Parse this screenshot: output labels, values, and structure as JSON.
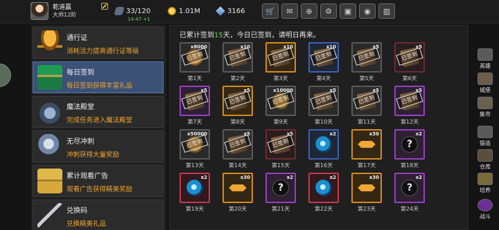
{
  "player": {
    "name": "乾道赢",
    "rank": "大师12阶",
    "timer": "14:47 +1"
  },
  "resources": [
    {
      "icon": "energy-icon",
      "value": "33/120"
    },
    {
      "icon": "gold-coin-icon",
      "value": "1.01M"
    },
    {
      "icon": "diamond-icon",
      "value": "3166"
    }
  ],
  "toolbar": [
    {
      "icon": "shop-cart-icon",
      "glyph": "🛒"
    },
    {
      "icon": "mail-icon",
      "glyph": "✉"
    },
    {
      "icon": "gamepad-icon",
      "glyph": "⊕"
    },
    {
      "icon": "settings-gear-icon",
      "glyph": "⚙"
    },
    {
      "icon": "gift-icon",
      "glyph": "▣"
    },
    {
      "icon": "color-wheel-icon",
      "glyph": "◉"
    },
    {
      "icon": "stats-chart-icon",
      "glyph": "▥"
    }
  ],
  "menu": [
    {
      "title": "通行证",
      "subtitle": "消耗活力提高通行证等级"
    },
    {
      "title": "每日签到",
      "subtitle": "每日签到获得丰富礼品"
    },
    {
      "title": "魔法殿堂",
      "subtitle": "完成任务进入魔法殿堂"
    },
    {
      "title": "无尽冲刺",
      "subtitle": "冲刺获得大量奖励"
    },
    {
      "title": "累计观看广告",
      "subtitle": "观看广告获得精美奖励"
    },
    {
      "title": "兑换码",
      "subtitle": "兑换精美礼品"
    }
  ],
  "main": {
    "msg_prefix": "已累计签到",
    "msg_count": "15",
    "msg_suffix": "天，今日已签到，请明日再来。"
  },
  "signed_label": "已签到",
  "rewards": [
    {
      "day": "第1天",
      "qty": "x8000",
      "item": "gold-coin",
      "rarity": "gray",
      "signed": true
    },
    {
      "day": "第2天",
      "qty": "x10",
      "item": "card-pack",
      "rarity": "gray",
      "signed": true
    },
    {
      "day": "第3天",
      "qty": "x10",
      "item": "card-pack",
      "rarity": "orange",
      "signed": true
    },
    {
      "day": "第4天",
      "qty": "x10",
      "item": "card-pack",
      "rarity": "blue",
      "signed": true
    },
    {
      "day": "第5天",
      "qty": "x5",
      "item": "card-pack",
      "rarity": "gray",
      "signed": true
    },
    {
      "day": "第6天",
      "qty": "x5",
      "item": "card-pack",
      "rarity": "darkred",
      "signed": true
    },
    {
      "day": "第7天",
      "qty": "x5",
      "item": "card-pack",
      "rarity": "purple",
      "signed": true
    },
    {
      "day": "第8天",
      "qty": "x5",
      "item": "card-pack",
      "rarity": "orange",
      "signed": true
    },
    {
      "day": "第9天",
      "qty": "x10000",
      "item": "gold-coin",
      "rarity": "gray",
      "signed": true
    },
    {
      "day": "第10天",
      "qty": "x5",
      "item": "card-pack",
      "rarity": "gray",
      "signed": true
    },
    {
      "day": "第11天",
      "qty": "x5",
      "item": "card-pack",
      "rarity": "gray",
      "signed": true
    },
    {
      "day": "第12天",
      "qty": "x5",
      "item": "card-pack",
      "rarity": "purple",
      "signed": true
    },
    {
      "day": "第13天",
      "qty": "x50000",
      "item": "gold-coin",
      "rarity": "gray",
      "signed": true
    },
    {
      "day": "第14天",
      "qty": "x5",
      "item": "card-pack",
      "rarity": "gray",
      "signed": true
    },
    {
      "day": "第15天",
      "qty": "x5",
      "item": "card-pack",
      "rarity": "darkred",
      "signed": true
    },
    {
      "day": "第16天",
      "qty": "x2",
      "item": "blue-orb",
      "rarity": "blue",
      "signed": false
    },
    {
      "day": "第17天",
      "qty": "x30",
      "item": "crystal",
      "rarity": "orange",
      "signed": false
    },
    {
      "day": "第18天",
      "qty": "x2",
      "item": "mystery",
      "rarity": "purple",
      "signed": false
    },
    {
      "day": "第19天",
      "qty": "x2",
      "item": "blue-orb",
      "rarity": "red",
      "signed": false
    },
    {
      "day": "第20天",
      "qty": "x30",
      "item": "crystal",
      "rarity": "orange",
      "signed": false
    },
    {
      "day": "第21天",
      "qty": "x2",
      "item": "mystery",
      "rarity": "purple",
      "signed": false
    },
    {
      "day": "第22天",
      "qty": "x2",
      "item": "blue-orb",
      "rarity": "red",
      "signed": false
    },
    {
      "day": "第23天",
      "qty": "x30",
      "item": "crystal",
      "rarity": "orange",
      "signed": false
    },
    {
      "day": "第24天",
      "qty": "x2",
      "item": "mystery",
      "rarity": "purple",
      "signed": false
    }
  ],
  "sidebar_right": [
    {
      "icon": "hero-icon",
      "label": "英雄",
      "color": "#5a5a5a"
    },
    {
      "icon": "castle-icon",
      "label": "城堡",
      "color": "#6d5c48"
    },
    {
      "icon": "market-icon",
      "label": "集市",
      "color": "#6b5f50"
    },
    {
      "icon": "forge-icon",
      "label": "锻造",
      "color": "#595959"
    },
    {
      "icon": "warehouse-icon",
      "label": "仓库",
      "color": "#5c4e3c"
    },
    {
      "icon": "upgrade-icon",
      "label": "培养",
      "color": "#7a6a3a"
    },
    {
      "icon": "battle-icon",
      "label": "战斗",
      "color": "#6a2d9a"
    }
  ]
}
